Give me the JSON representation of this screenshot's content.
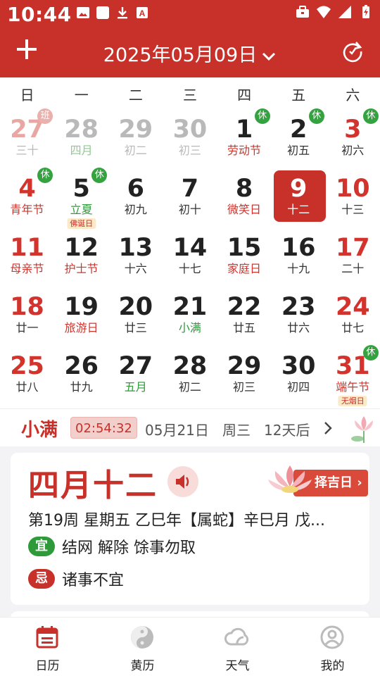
{
  "status": {
    "time": "10:44"
  },
  "header": {
    "title": "2025年05月09日",
    "add_icon": "plus-icon",
    "dropdown_icon": "chevron-down-icon",
    "refresh_icon": "refresh-icon"
  },
  "weekdays": [
    "日",
    "一",
    "二",
    "三",
    "四",
    "五",
    "六"
  ],
  "calendar": {
    "rows": [
      [
        {
          "day": "27",
          "lunar": "三十",
          "other": true,
          "holred": true,
          "badge": "班",
          "badge_type": "ban"
        },
        {
          "day": "28",
          "lunar": "四月",
          "other": true,
          "lunar_style": "lgreen"
        },
        {
          "day": "29",
          "lunar": "初二",
          "other": true
        },
        {
          "day": "30",
          "lunar": "初三",
          "other": true
        },
        {
          "day": "1",
          "lunar": "劳动节",
          "lunar_style": "red",
          "badge": "休"
        },
        {
          "day": "2",
          "lunar": "初五",
          "badge": "休"
        },
        {
          "day": "3",
          "lunar": "初六",
          "weekend": true,
          "badge": "休"
        }
      ],
      [
        {
          "day": "4",
          "lunar": "青年节",
          "weekend": true,
          "lunar_style": "red",
          "badge": "休"
        },
        {
          "day": "5",
          "lunar": "立夏",
          "lunar_style": "green",
          "badge": "休",
          "tag": "佛诞日"
        },
        {
          "day": "6",
          "lunar": "初九"
        },
        {
          "day": "7",
          "lunar": "初十"
        },
        {
          "day": "8",
          "lunar": "微笑日",
          "lunar_style": "red"
        },
        {
          "day": "9",
          "lunar": "十二",
          "selected": true
        },
        {
          "day": "10",
          "lunar": "十三",
          "weekend": true
        }
      ],
      [
        {
          "day": "11",
          "lunar": "母亲节",
          "weekend": true,
          "lunar_style": "red"
        },
        {
          "day": "12",
          "lunar": "护士节",
          "lunar_style": "red"
        },
        {
          "day": "13",
          "lunar": "十六"
        },
        {
          "day": "14",
          "lunar": "十七"
        },
        {
          "day": "15",
          "lunar": "家庭日",
          "lunar_style": "red"
        },
        {
          "day": "16",
          "lunar": "十九"
        },
        {
          "day": "17",
          "lunar": "二十",
          "weekend": true
        }
      ],
      [
        {
          "day": "18",
          "lunar": "廿一",
          "weekend": true
        },
        {
          "day": "19",
          "lunar": "旅游日",
          "lunar_style": "red"
        },
        {
          "day": "20",
          "lunar": "廿三"
        },
        {
          "day": "21",
          "lunar": "小满",
          "lunar_style": "green"
        },
        {
          "day": "22",
          "lunar": "廿五"
        },
        {
          "day": "23",
          "lunar": "廿六"
        },
        {
          "day": "24",
          "lunar": "廿七",
          "weekend": true
        }
      ],
      [
        {
          "day": "25",
          "lunar": "廿八",
          "weekend": true
        },
        {
          "day": "26",
          "lunar": "廿九"
        },
        {
          "day": "27",
          "lunar": "五月",
          "lunar_style": "green"
        },
        {
          "day": "28",
          "lunar": "初二"
        },
        {
          "day": "29",
          "lunar": "初三"
        },
        {
          "day": "30",
          "lunar": "初四"
        },
        {
          "day": "31",
          "lunar": "端午节",
          "weekend": true,
          "lunar_style": "red",
          "badge": "休",
          "tag": "无烟日"
        }
      ]
    ]
  },
  "term": {
    "name": "小满",
    "countdown": "02:54:32",
    "date": "05月21日",
    "weekday": "周三",
    "after": "12天后"
  },
  "card": {
    "lunar_date": "四月十二",
    "zejiri_label": "择吉日",
    "info_line": "第19周 星期五 乙巳年【属蛇】辛巳月 戊...",
    "yi_label": "宜",
    "yi_text": "结网 解除 馀事勿取",
    "ji_label": "忌",
    "ji_text": "诸事不宜"
  },
  "nav": [
    {
      "label": "日历",
      "icon": "calendar-icon"
    },
    {
      "label": "黄历",
      "icon": "yin-yang-icon"
    },
    {
      "label": "天气",
      "icon": "weather-icon"
    },
    {
      "label": "我的",
      "icon": "user-icon"
    }
  ],
  "colors": {
    "brand": "#c8302a",
    "green": "#35a240"
  }
}
